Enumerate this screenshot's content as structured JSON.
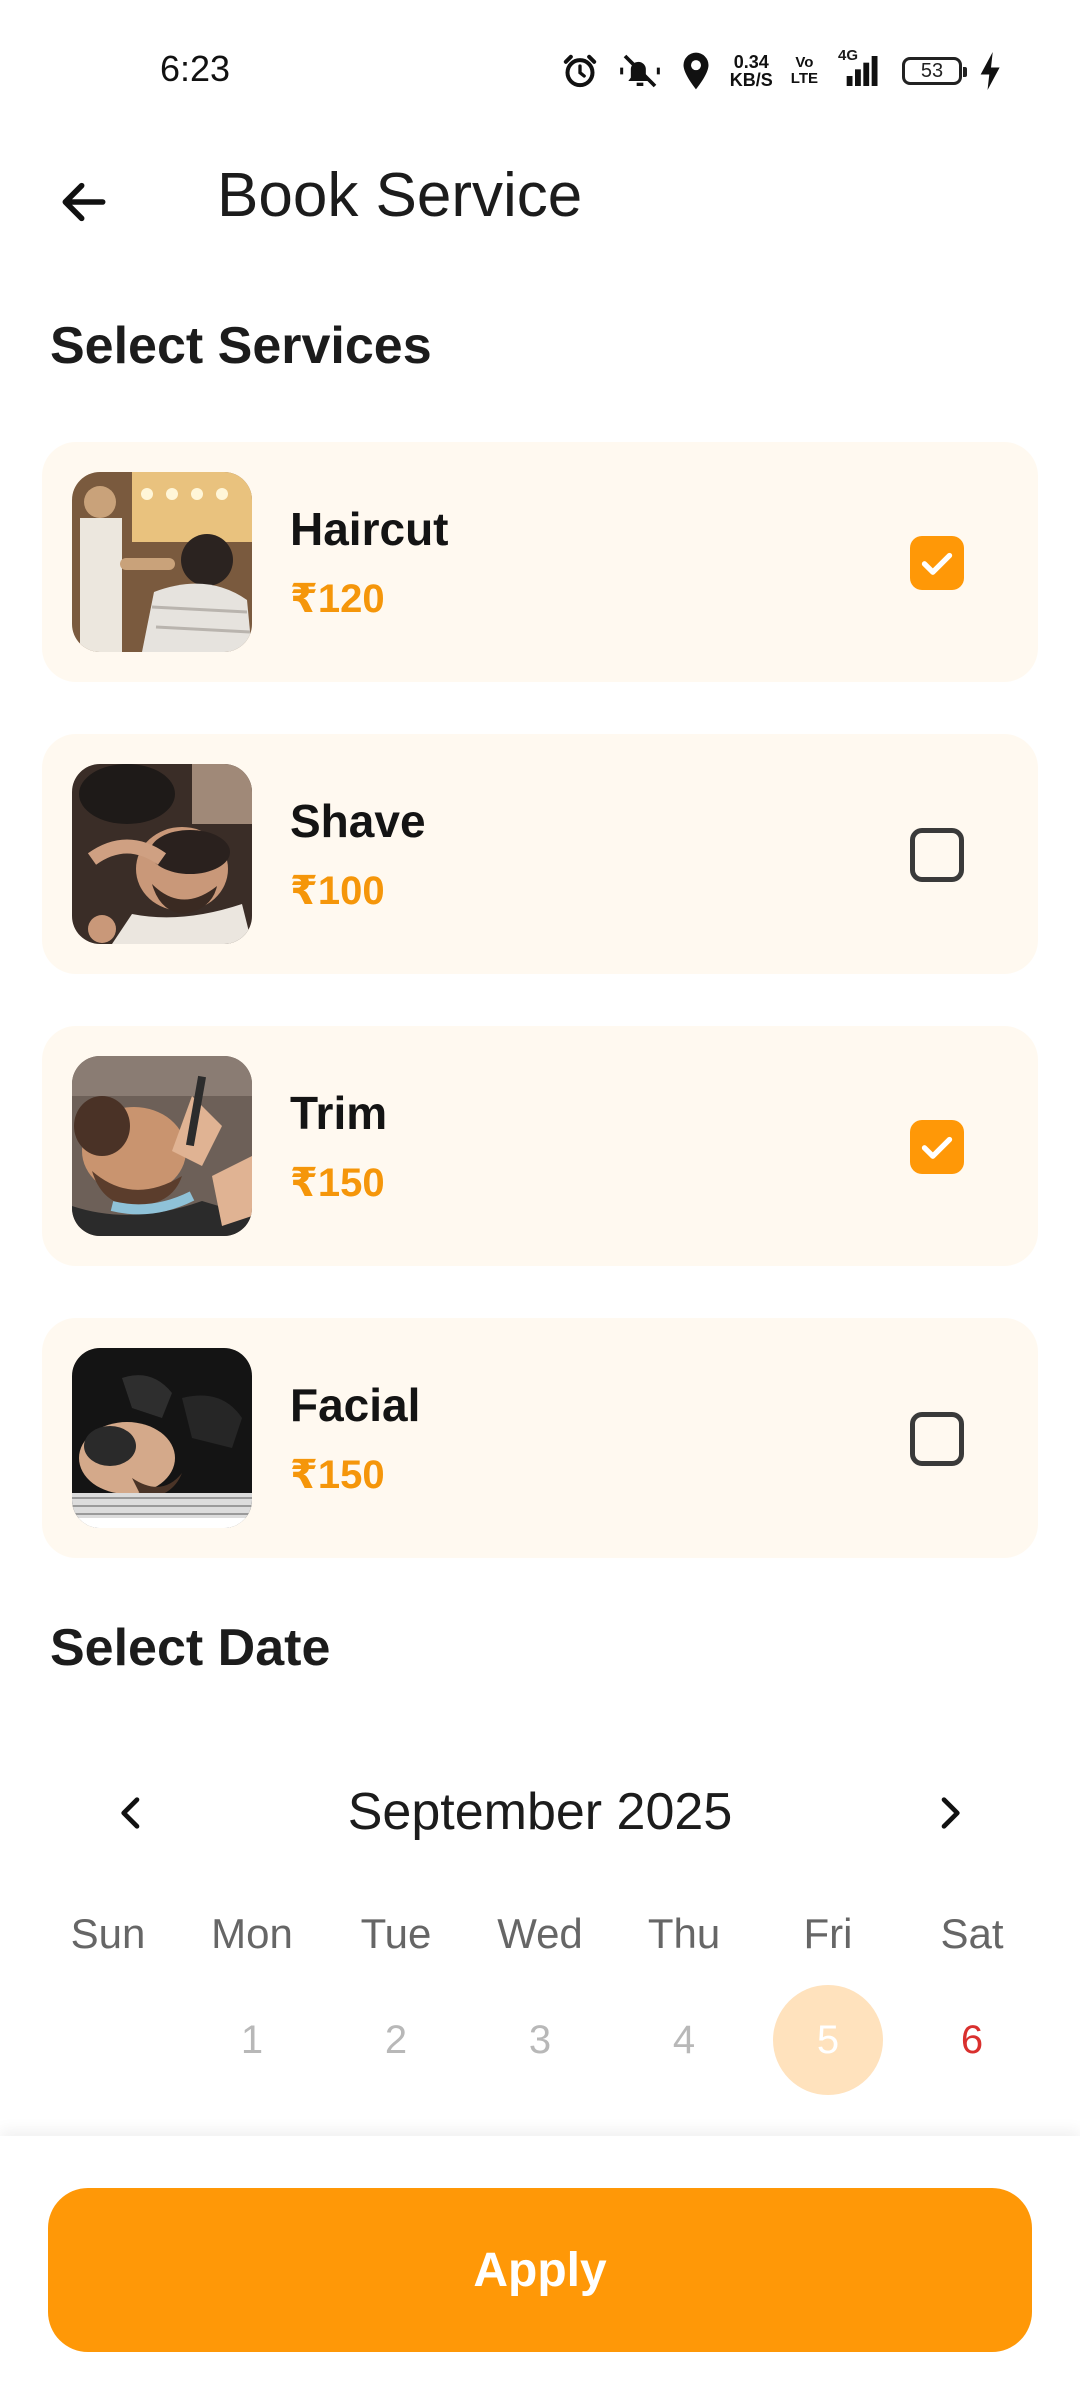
{
  "status_bar": {
    "time": "6:23",
    "net_speed_value": "0.34",
    "net_speed_unit": "KB/S",
    "volte_top": "Vo",
    "volte_bottom": "LTE",
    "network": "4G",
    "battery": "53",
    "icons": [
      "alarm-icon",
      "mute-icon",
      "location-icon",
      "signal-icon",
      "battery-icon",
      "charging-icon"
    ]
  },
  "app_bar": {
    "title": "Book Service",
    "back_icon": "arrow-left-icon"
  },
  "services_section": {
    "heading": "Select Services",
    "items": [
      {
        "name": "Haircut",
        "price": "₹120",
        "checked": true
      },
      {
        "name": "Shave",
        "price": "₹100",
        "checked": false
      },
      {
        "name": "Trim",
        "price": "₹150",
        "checked": true
      },
      {
        "name": "Facial",
        "price": "₹150",
        "checked": false
      }
    ]
  },
  "date_section": {
    "heading": "Select Date",
    "month_label": "September 2025",
    "weekdays": [
      "Sun",
      "Mon",
      "Tue",
      "Wed",
      "Thu",
      "Fri",
      "Sat"
    ],
    "days": [
      "1",
      "2",
      "3",
      "4",
      "5",
      "6"
    ],
    "selected_day": "5"
  },
  "apply_label": "Apply",
  "colors": {
    "accent": "#ff9807",
    "price": "#f5960a",
    "card_bg": "#fff9f0",
    "selected_day_bg": "#ffe2bd",
    "saturday": "#d9302e"
  }
}
